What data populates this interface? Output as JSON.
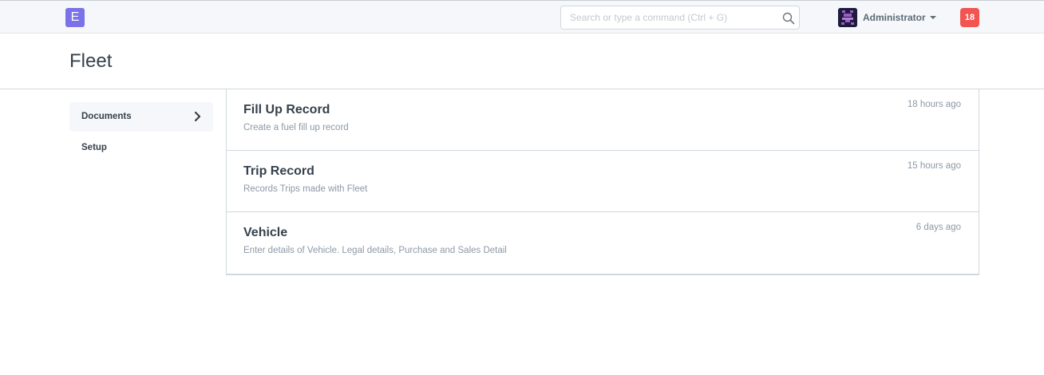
{
  "navbar": {
    "logo_letter": "E",
    "search_placeholder": "Search or type a command (Ctrl + G)",
    "user_name": "Administrator",
    "notification_count": "18",
    "icons": [
      "search-icon",
      "avatar-icon",
      "caret-down-icon"
    ]
  },
  "page": {
    "title": "Fleet"
  },
  "sidebar": {
    "items": [
      {
        "label": "Documents",
        "active": true
      },
      {
        "label": "Setup",
        "active": false
      }
    ]
  },
  "list": {
    "rows": [
      {
        "title": "Fill Up Record",
        "description": "Create a fuel fill up record",
        "time": "18 hours ago"
      },
      {
        "title": "Trip Record",
        "description": "Records Trips made with Fleet",
        "time": "15 hours ago"
      },
      {
        "title": "Vehicle",
        "description": "Enter details of Vehicle. Legal details, Purchase and Sales Detail",
        "time": "6 days ago"
      }
    ]
  },
  "colors": {
    "logo": "#7b72e9",
    "notification": "#f25450",
    "navbar_bg": "#f5f7fa",
    "text_primary": "#36414c",
    "text_muted": "#8d99a6"
  }
}
